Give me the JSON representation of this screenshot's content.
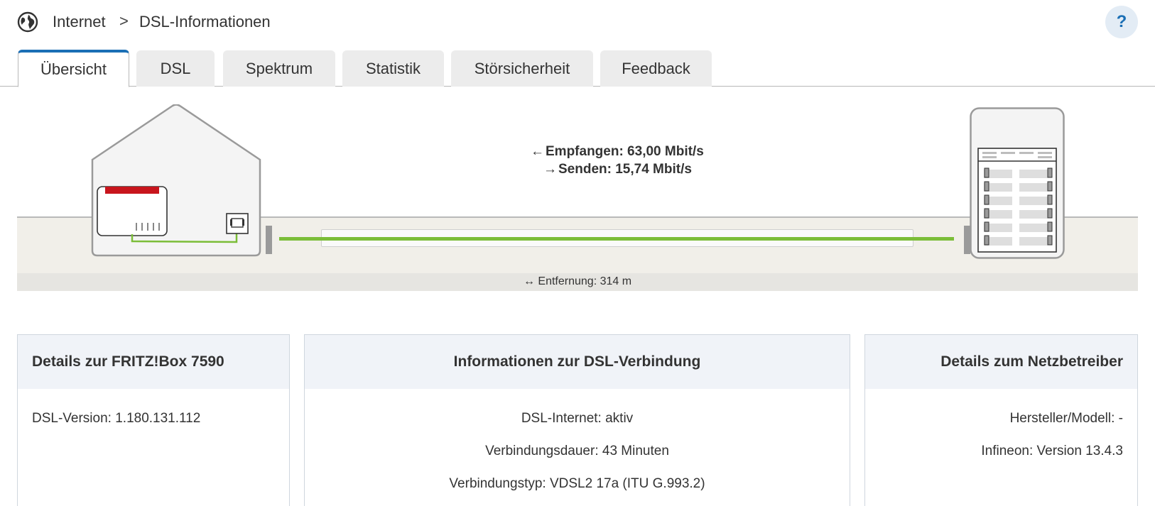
{
  "breadcrumb": {
    "section": "Internet",
    "separator": ">",
    "page": "DSL-Informationen",
    "icon": "globe-icon"
  },
  "help": {
    "label": "?"
  },
  "tabs": [
    {
      "label": "Übersicht",
      "active": true
    },
    {
      "label": "DSL",
      "active": false
    },
    {
      "label": "Spektrum",
      "active": false
    },
    {
      "label": "Statistik",
      "active": false
    },
    {
      "label": "Störsicherheit",
      "active": false
    },
    {
      "label": "Feedback",
      "active": false
    }
  ],
  "connection": {
    "receive_arrow": "←",
    "receive": "Empfangen: 63,00 Mbit/s",
    "send_arrow": "→",
    "send": "Senden: 15,74 Mbit/s",
    "distance_arrow": "↔",
    "distance": "Entfernung: 314 m"
  },
  "cards": {
    "fritzbox": {
      "title": "Details zur FRITZ!Box 7590",
      "lines": [
        "DSL-Version: 1.180.131.112"
      ]
    },
    "dsl": {
      "title": "Informationen zur DSL-Verbindung",
      "lines": [
        "DSL-Internet: aktiv",
        "Verbindungsdauer: 43 Minuten",
        "Verbindungstyp: VDSL2 17a (ITU G.993.2)"
      ]
    },
    "provider": {
      "title": "Details zum Netzbetreiber",
      "lines": [
        "Hersteller/Modell: -",
        "Infineon: Version 13.4.3"
      ]
    }
  },
  "colors": {
    "accent": "#1b6fb5",
    "line_active": "#7bbd38",
    "router_red": "#c8151d",
    "card_header_bg": "#f0f3f8"
  }
}
